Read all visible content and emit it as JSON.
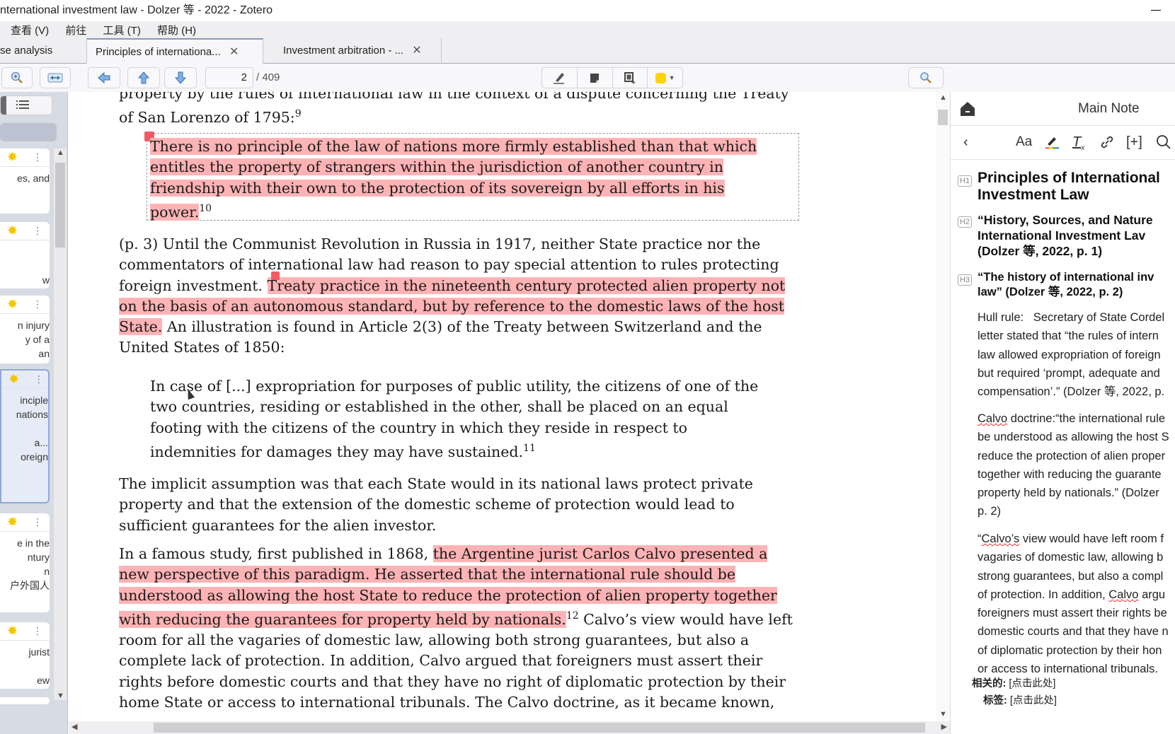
{
  "window": {
    "title": "nternational investment law - Dolzer 等 - 2022 - Zotero"
  },
  "menubar": {
    "items": [
      "查看 (V)",
      "前往",
      "工具 (T)",
      "帮助 (H)"
    ]
  },
  "tabs": [
    {
      "label": "se analysis",
      "active": false
    },
    {
      "label": "Principles of internationa...",
      "active": true,
      "close": "✕"
    },
    {
      "label": "Investment arbitration - ...",
      "active": false,
      "close": "✕"
    }
  ],
  "toolbar": {
    "zoom_in_icon": "magnifier-plus",
    "fit_width_icon": "double-arrow",
    "back_icon": "arrow-left",
    "prev_page_icon": "arrow-up",
    "next_page_icon": "arrow-down",
    "current_page": "2",
    "total_pages": "/ 409",
    "annotation_tools": [
      "highlight",
      "note",
      "area",
      "color"
    ],
    "highlight_color": "#ffd400",
    "search_icon": "magnifier"
  },
  "sidebar": {
    "cards": [
      {
        "text": "es, and"
      },
      {
        "text": "\n\nw"
      },
      {
        "text": "n injury\ny of a\nan"
      },
      {
        "text": "inciple\nnations\n\na...\noreign",
        "selected": true
      },
      {
        "text": "e in the\nntury\nn\n户外国人"
      },
      {
        "text": "jurist\n\new"
      }
    ]
  },
  "document": {
    "line0": "property by the rules of international law in the context of a dispute concerning the Treaty",
    "line1": "of San Lorenzo of 1795:",
    "fn9": "9",
    "quote_lines": [
      "There is no principle of the law of nations more firmly established than that which",
      "entitles the property of strangers within the jurisdiction of another country in",
      "friendship with their own to the protection of its sovereign by all efforts in his",
      "power."
    ],
    "fn10": "10",
    "para2": {
      "l1": "(p. 3) Until the Communist Revolution in Russia in 1917, neither State practice nor the",
      "l2": "commentators of international law had reason to pay special attention to rules protecting",
      "l3a": "foreign investment. ",
      "l3b": "Treaty practice in the nineteenth century protected alien property not",
      "l4": "on the basis of an autonomous standard, but by reference to the domestic laws of the host",
      "l5a": "State.",
      "l5b": " An illustration is found in Article 2(3) of the Treaty between Switzerland and the",
      "l6": "United States of 1850:"
    },
    "quote2_lines": [
      "In case of [...] expropriation for purposes of public utility, the citizens of one of the",
      "two countries, residing or established in the other, shall be placed on an equal",
      "footing with the citizens of the country in which they reside in respect to",
      "indemnities for damages they may have sustained."
    ],
    "fn11": "11",
    "para3": [
      "The implicit assumption was that each State would in its national laws protect private",
      "property and that the extension of the domestic scheme of protection would lead to",
      "sufficient guarantees for the alien investor."
    ],
    "para4": {
      "l1a": "In a famous study, first published in 1868, ",
      "l1b": "the Argentine jurist Carlos Calvo presented a",
      "l2": "new perspective of this paradigm. He asserted that the international rule should be",
      "l3": "understood as allowing the host State to reduce the protection of alien property together",
      "l4a": "with reducing the guarantees for property held by nationals.",
      "fn12": "12",
      "l4b": " Calvo’s view would have left",
      "l5": "room for all the vagaries of domestic law, allowing both strong guarantees, but also a",
      "l6": "complete lack of protection. In addition, Calvo argued that foreigners must assert their",
      "l7": "rights before domestic courts and that they have no right of diplomatic protection by their",
      "l8": "home State or access to international tribunals. The Calvo doctrine, as it became known,"
    },
    "highlight_color": "#ffb3b5"
  },
  "notepane": {
    "header_title": "Main Note",
    "tools": [
      "‹",
      "Aa",
      "highlight-pen",
      "clear-format",
      "link",
      "[+]",
      "search"
    ],
    "h1_badge": "H1",
    "h1": "Principles of International\nInvestment Law",
    "h2_badge": "H2",
    "h2": "“History, Sources, and Nature\nInternational Investment Lav\n(Dolzer 等, 2022, p. 1)",
    "h3_badge": "H3",
    "h3": "“The history of international inv\nlaw” (Dolzer 等, 2022, p. 2)",
    "hull": "Hull rule:   Secretary of State Cordel\nletter stated that “the rules of intern\nlaw allowed expropriation of foreign\nbut required ‘prompt, adequate and\ncompensation’.” (Dolzer 等, 2022, p.",
    "calvo_word": "Calvo",
    "calvo_rest": " doctrine:“the international rule\nbe understood as allowing the host S\nreduce the protection of alien proper\ntogether with reducing the guarante\nproperty held by nationals.” (Dolzer\np. 2)",
    "q_open": "“",
    "q_calvos": "Calvo’s",
    "q_l1": " view would have left room f",
    "q_rest1": "vagaries of domestic law, allowing b\nstrong guarantees, but also a compl\nof protection. In addition, ",
    "q_calvo2": "Calvo",
    "q_l4": " argu",
    "q_rest2": "foreigners must assert their rights be\ndomestic courts and that they have n\nof diplomatic protection by their hon\nor access to international tribunals.",
    "related_label": "相关的:",
    "related_value": "[点击此处]",
    "tags_label": "标签:",
    "tags_value": "[点击此处]"
  }
}
